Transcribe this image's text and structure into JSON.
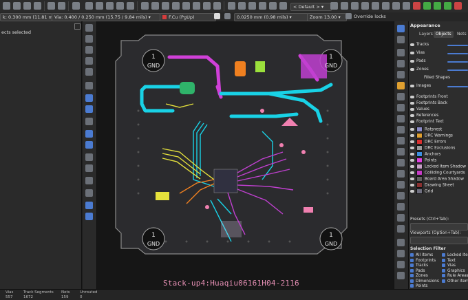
{
  "toolbar": {
    "track_width": "k: 0.300 mm (11.81 mils)",
    "via_size": "Via: 0.400 / 0.250 mm (15.75 / 9.84 mils)",
    "layer": "F.Cu (PgUp)",
    "grid": "0.0250 mm (0.98 mils)",
    "zoom": "Zoom 13.00",
    "override_locks": "Override locks",
    "preset": "< Default >",
    "layer_color": "#d63c3c"
  },
  "left_panel": {
    "title": "ects selected"
  },
  "board": {
    "gnd_label": "GND",
    "hole_number": "1",
    "stack_label": "Stack-up4:Huaqiu06161H04-2116"
  },
  "appearance": {
    "title": "Appearance",
    "tabs": [
      "Layers",
      "Objects",
      "Nets"
    ],
    "active_tab": "Objects",
    "visibility": [
      "Tracks",
      "Vias",
      "Pads",
      "Zones",
      "Filled Shapes",
      "Images"
    ],
    "footprints": [
      "Footprints Front",
      "Footprints Back",
      "Values",
      "References",
      "Footprint Text"
    ],
    "objects": [
      {
        "label": "Ratsnest",
        "color": "#8c8cc8"
      },
      {
        "label": "DRC Warnings",
        "color": "#e0a030"
      },
      {
        "label": "DRC Errors",
        "color": "#d83030"
      },
      {
        "label": "DRC Exclusions",
        "color": "#9a9a9a"
      },
      {
        "label": "Anchors",
        "color": "#3c8fe0"
      },
      {
        "label": "Points",
        "color": "#e040e0"
      },
      {
        "label": "Locked Item Shadow",
        "color": "#c8a0c8"
      },
      {
        "label": "Colliding Courtyards",
        "color": "#c83cc8"
      },
      {
        "label": "Board Area Shadow",
        "color": "#606060"
      },
      {
        "label": "Drawing Sheet",
        "color": "#8a3030"
      },
      {
        "label": "Grid",
        "color": "#707080"
      }
    ],
    "presets_label": "Presets (Ctrl+Tab):",
    "viewports_label": "Viewports (Option+Tab):"
  },
  "selection_filter": {
    "title": "Selection Filter",
    "col1": [
      "All items",
      "Footprints",
      "Tracks",
      "Pads",
      "Zones",
      "Dimensions",
      "Points"
    ],
    "col2": [
      "Locked Items",
      "Text",
      "Vias",
      "Graphics",
      "Rule Areas",
      "Other items"
    ]
  },
  "status": {
    "vias_label": "Vias",
    "vias": "557",
    "tracks_label": "Track Segments",
    "tracks": "1672",
    "nets_label": "Nets",
    "nets": "159",
    "unrouted_label": "Unrouted",
    "unrouted": "0"
  }
}
